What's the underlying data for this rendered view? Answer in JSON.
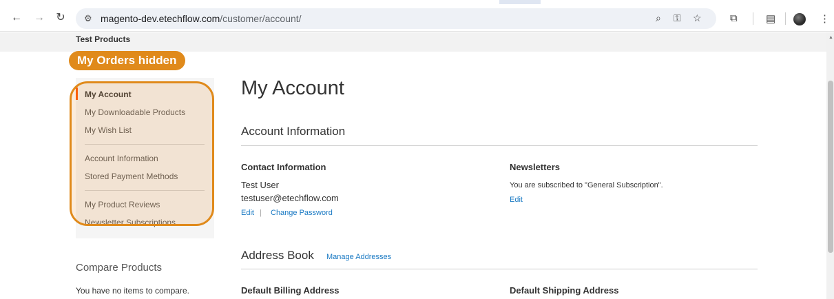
{
  "browser": {
    "url_host": "magento-dev.etechflow.com",
    "url_path": "/customer/account/",
    "icons": [
      "back-icon",
      "forward-icon",
      "reload-icon",
      "site-info-icon",
      "zoom-icon",
      "password-key-icon",
      "bookmark-star-icon",
      "extensions-icon",
      "reading-list-icon",
      "profile-avatar",
      "menu-icon"
    ]
  },
  "header": {
    "store_label": "Test Products"
  },
  "annotation": {
    "label": "My Orders hidden",
    "color": "#e08a1b"
  },
  "sidebar": {
    "items": [
      {
        "label": "My Account",
        "current": true
      },
      {
        "label": "My Downloadable Products"
      },
      {
        "label": "My Wish List"
      },
      {
        "label": "Account Information"
      },
      {
        "label": "Stored Payment Methods"
      },
      {
        "label": "My Product Reviews"
      },
      {
        "label": "Newsletter Subscriptions"
      }
    ]
  },
  "compare": {
    "title": "Compare Products",
    "empty_text": "You have no items to compare."
  },
  "main": {
    "title": "My Account",
    "account_info": {
      "title": "Account Information",
      "contact": {
        "title": "Contact Information",
        "name": "Test User",
        "email": "testuser@etechflow.com",
        "edit_label": "Edit",
        "separator": "|",
        "change_password_label": "Change Password"
      },
      "newsletters": {
        "title": "Newsletters",
        "text": "You are subscribed to \"General Subscription\".",
        "edit_label": "Edit"
      }
    },
    "address_book": {
      "title": "Address Book",
      "manage_label": "Manage Addresses",
      "billing_title": "Default Billing Address",
      "shipping_title": "Default Shipping Address"
    }
  },
  "colors": {
    "link": "#1979c3",
    "accent": "#ff5501",
    "annotation": "#e08a1b"
  }
}
